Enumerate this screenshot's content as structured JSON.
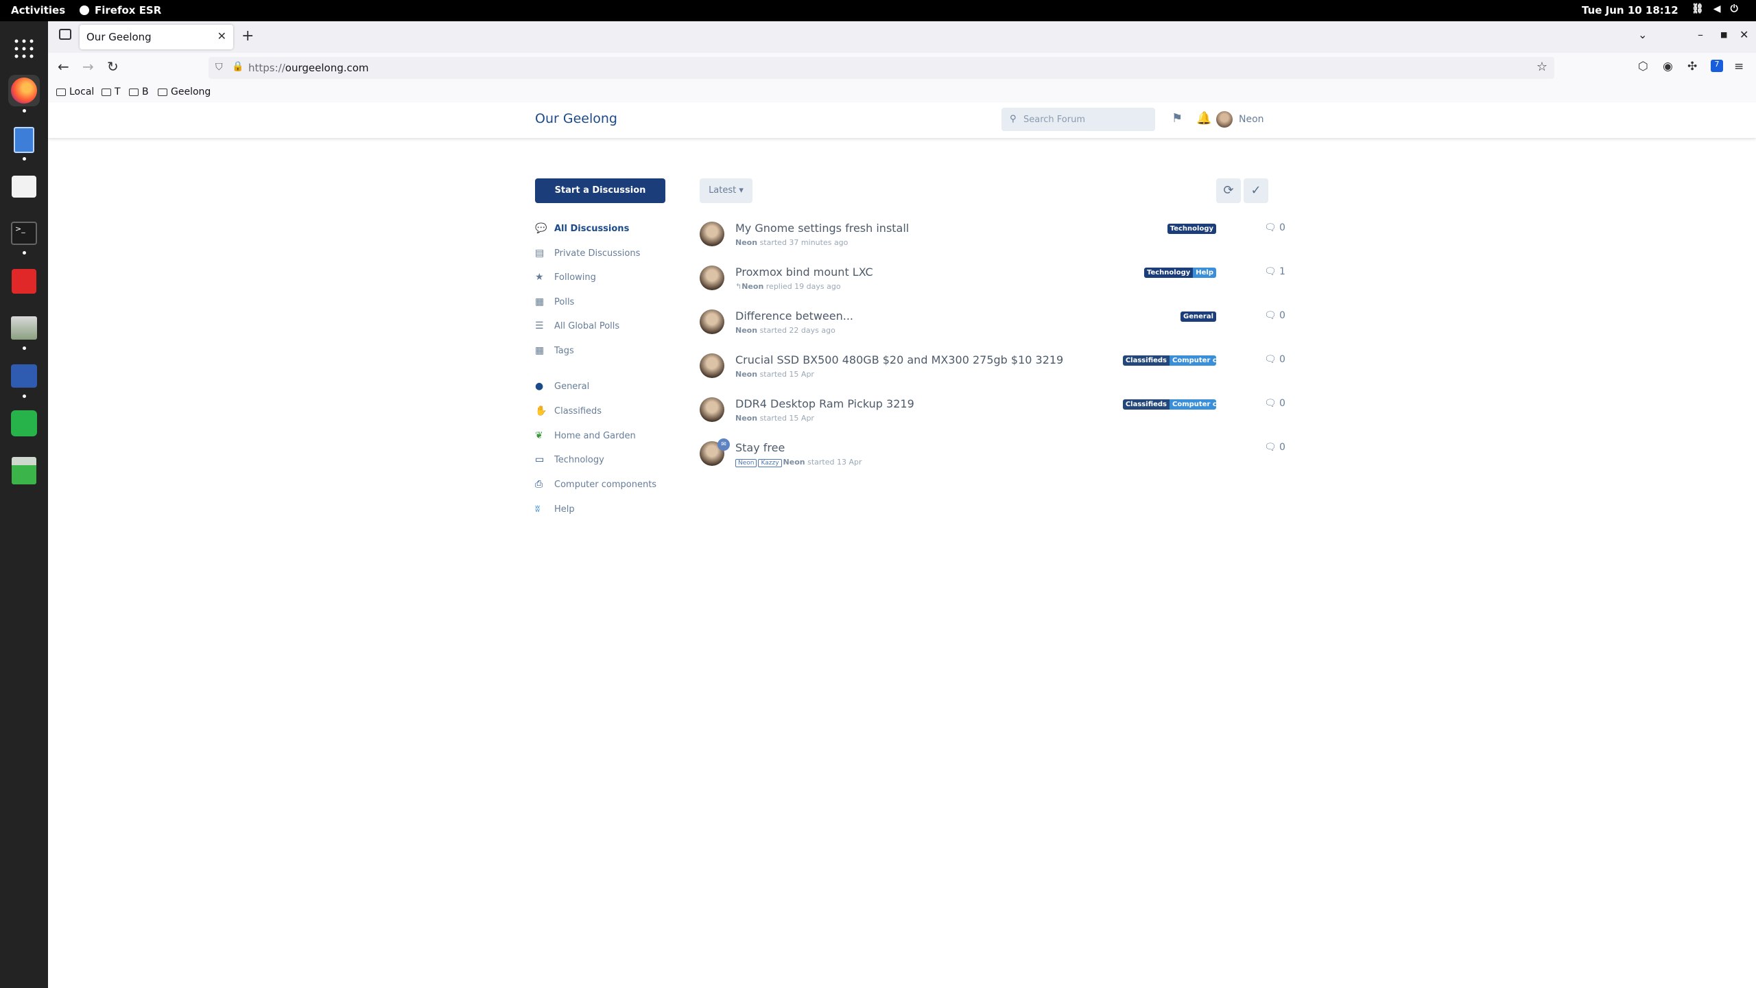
{
  "system": {
    "activities": "Activities",
    "app_name": "Firefox ESR",
    "clock": "Tue Jun 10  18:12"
  },
  "browser": {
    "tab_title": "Our Geelong",
    "url_scheme": "https://",
    "url_host": "ourgeelong.com",
    "bookmarks": [
      "Local",
      "T",
      "B",
      "Geelong"
    ],
    "extension_badge": "7"
  },
  "forum": {
    "site_title": "Our Geelong",
    "search_placeholder": "Search Forum",
    "user_name": "Neon",
    "start_button": "Start a Discussion",
    "sort_label": "Latest",
    "nav": [
      {
        "label": "All Discussions",
        "icon": "comments-icon",
        "active": true
      },
      {
        "label": "Private Discussions",
        "icon": "map-icon"
      },
      {
        "label": "Following",
        "icon": "star-icon"
      },
      {
        "label": "Polls",
        "icon": "poll-icon"
      },
      {
        "label": "All Global Polls",
        "icon": "list-icon"
      },
      {
        "label": "Tags",
        "icon": "tags-grid-icon"
      }
    ],
    "tags_nav": [
      {
        "label": "General",
        "icon": "comment-icon",
        "color": "#1b4a8a"
      },
      {
        "label": "Classifieds",
        "icon": "hand-holding-icon",
        "color": "#1b4a8a"
      },
      {
        "label": "Home and Garden",
        "icon": "seedling-icon",
        "color": "#3a9a3a"
      },
      {
        "label": "Technology",
        "icon": "desktop-icon",
        "color": "#1b4a8a"
      },
      {
        "label": "Computer components",
        "icon": "print-icon",
        "color": "#1b4a8a"
      },
      {
        "label": "Help",
        "icon": "hands-icon",
        "color": "#3a8fd8"
      }
    ],
    "discussions": [
      {
        "title": "My Gnome settings fresh install",
        "author": "Neon",
        "action": "started 37 minutes ago",
        "tags": [
          {
            "label": "Technology",
            "color": "#1b3d7a"
          }
        ],
        "replies": "0"
      },
      {
        "title": "Proxmox bind mount LXC",
        "author": "Neon",
        "action": "replied 19 days ago",
        "reply_icon": true,
        "tags": [
          {
            "label": "Technology",
            "color": "#1b3d7a"
          },
          {
            "label": "Help",
            "color": "#3a8fd8"
          }
        ],
        "replies": "1"
      },
      {
        "title": "Difference between...",
        "author": "Neon",
        "action": "started 22 days ago",
        "tags": [
          {
            "label": "General",
            "color": "#1b3d7a"
          }
        ],
        "replies": "0"
      },
      {
        "title": "Crucial SSD BX500 480GB $20 and MX300 275gb $10 3219",
        "author": "Neon",
        "action": "started 15 Apr",
        "tags": [
          {
            "label": "Classifieds",
            "color": "#24477a"
          },
          {
            "label": "Computer components",
            "color": "#3a8fd8"
          }
        ],
        "replies": "0"
      },
      {
        "title": "DDR4 Desktop Ram Pickup 3219",
        "author": "Neon",
        "action": "started 15 Apr",
        "tags": [
          {
            "label": "Classifieds",
            "color": "#24477a"
          },
          {
            "label": "Computer components",
            "color": "#3a8fd8"
          }
        ],
        "replies": "0"
      },
      {
        "title": "Stay free",
        "author": "Neon",
        "action": "started 13 Apr",
        "recipients": [
          "Neon",
          "Kazzy"
        ],
        "tags": [],
        "replies": "0"
      }
    ]
  }
}
